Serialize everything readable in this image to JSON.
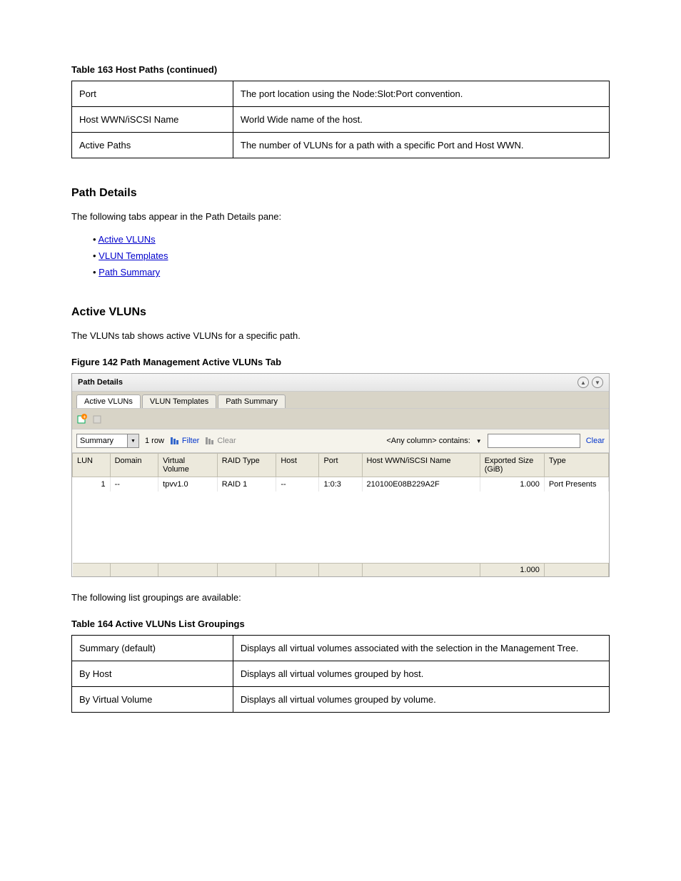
{
  "table163": {
    "caption": "Table 163 Host Paths (continued)",
    "rows": [
      [
        "Port",
        "The port location using the Node:Slot:Port convention."
      ],
      [
        "Host WWN/iSCSI Name",
        "World Wide name of the host."
      ],
      [
        "Active Paths",
        "The number of VLUNs for a path with a specific Port and Host WWN."
      ]
    ]
  },
  "path_details_heading": "Path Details",
  "path_details_intro": "The following tabs appear in the Path Details pane:",
  "links": [
    "Active VLUNs",
    "VLUN Templates",
    "Path Summary"
  ],
  "active_vluns_heading": "Active VLUNs",
  "active_vluns_text": "The VLUNs tab shows active VLUNs for a specific path.",
  "figure_caption": "Figure 142 Path Management Active VLUNs Tab",
  "panel": {
    "title": "Path Details",
    "tabs": [
      "Active VLUNs",
      "VLUN Templates",
      "Path Summary"
    ],
    "combo_value": "Summary",
    "row_count": "1 row",
    "filter_label": "Filter",
    "clear1_label": "Clear",
    "any_column_label": "<Any column> contains:",
    "clear2_label": "Clear",
    "headers": [
      "LUN",
      "Domain",
      "Virtual Volume",
      "RAID Type",
      "Host",
      "Port",
      "Host WWN/iSCSI Name",
      "Exported Size (GiB)",
      "Type"
    ],
    "row": {
      "lun": "1",
      "domain": "--",
      "vv": "tpvv1.0",
      "raid": "RAID 1",
      "host": "--",
      "port": "1:0:3",
      "wwn": "210100E08B229A2F",
      "size": "1.000",
      "type": "Port Presents"
    },
    "footer_total": "1.000"
  },
  "list_groupings_text": "The following list groupings are available:",
  "table164": {
    "caption": "Table 164 Active VLUNs List Groupings",
    "rows": [
      [
        "Summary (default)",
        "Displays all virtual volumes associated with the selection in the Management Tree."
      ],
      [
        "By Host",
        "Displays all virtual volumes grouped by host."
      ],
      [
        "By Virtual Volume",
        "Displays all virtual volumes grouped by volume."
      ]
    ]
  }
}
